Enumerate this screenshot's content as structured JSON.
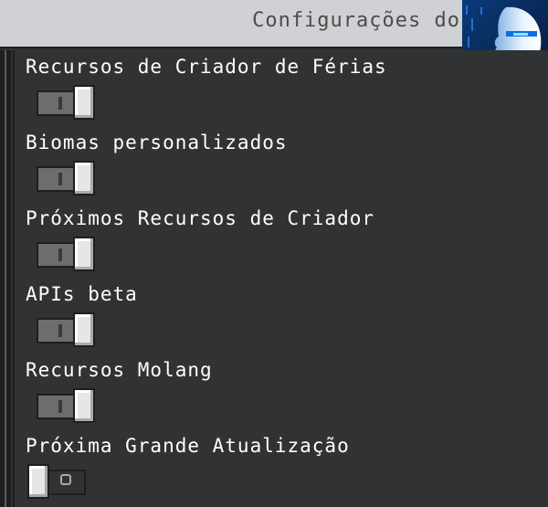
{
  "header": {
    "title": "Configurações do"
  },
  "settings": [
    {
      "label": "Recursos de Criador de Férias",
      "state": "on"
    },
    {
      "label": "Biomas personalizados",
      "state": "on"
    },
    {
      "label": "Próximos Recursos de Criador",
      "state": "on"
    },
    {
      "label": "APIs beta",
      "state": "on"
    },
    {
      "label": "Recursos Molang",
      "state": "on"
    },
    {
      "label": "Próxima Grande Atualização",
      "state": "off"
    }
  ],
  "colors": {
    "header_bg": "#d0d1d4",
    "panel_bg": "#313233",
    "label_text": "#ffffff"
  }
}
